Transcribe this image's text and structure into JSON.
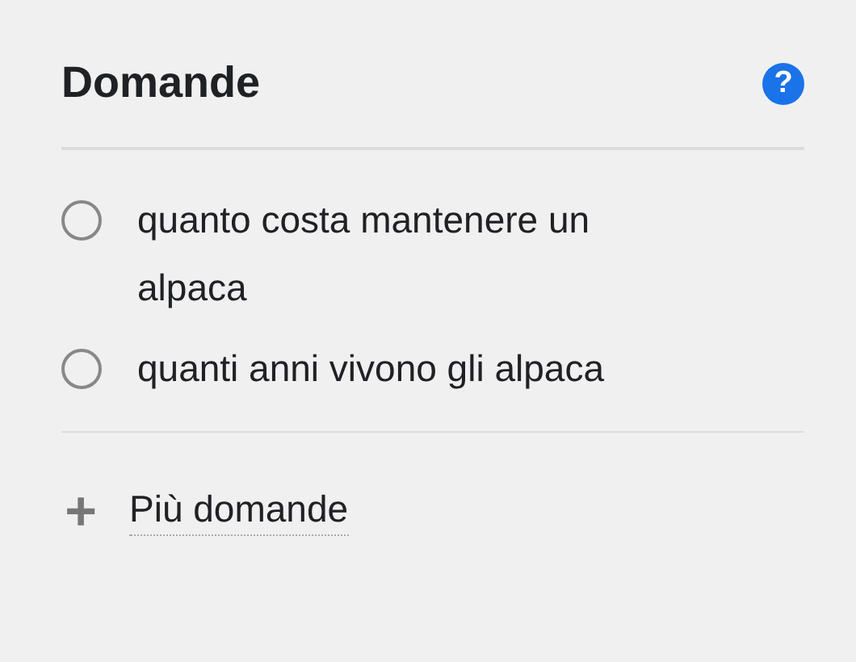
{
  "panel": {
    "title": "Domande",
    "help_icon": "?"
  },
  "questions": [
    {
      "text": "quanto costa mantenere un alpaca",
      "selected": false
    },
    {
      "text": "quanti anni vivono gli alpaca",
      "selected": false
    }
  ],
  "more": {
    "icon": "+",
    "label": "Più domande"
  }
}
